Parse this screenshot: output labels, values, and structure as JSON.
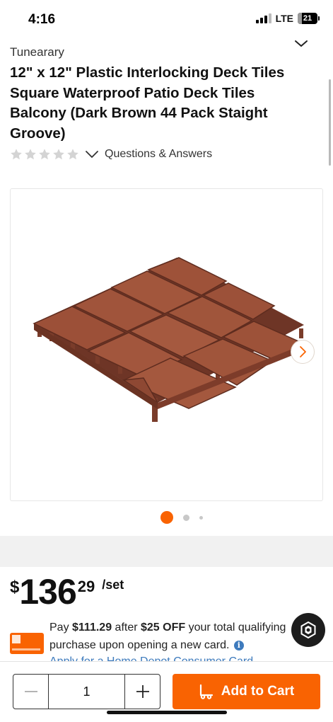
{
  "status_bar": {
    "time": "4:16",
    "network": "LTE",
    "battery": "21",
    "battery_level": 0.21
  },
  "product": {
    "brand": "Tunearary",
    "title": "12\" x 12\" Plastic Interlocking Deck Tiles Square Waterproof Patio Deck Tiles Balcony (Dark Brown 44 Pack Staight Groove)",
    "rating": 0,
    "rating_max": 5,
    "qa_label": "Questions & Answers",
    "image_icon": "deck-tiles-product-image"
  },
  "gallery": {
    "image_count": 3,
    "current_index": 0
  },
  "price": {
    "currency": "$",
    "dollars": "136",
    "cents": "29",
    "unit": "/set"
  },
  "promo": {
    "text_pay": "Pay ",
    "discounted_price": "$111.29",
    "text_after": " after ",
    "discount": "$25 OFF",
    "text_rest": " your total qualifying purchase upon opening a new card.",
    "info_glyph": "i",
    "apply_link": "Apply for a Home Depot Consumer Card"
  },
  "cart_bar": {
    "quantity": "1",
    "add_to_cart_label": "Add to Cart"
  },
  "colors": {
    "accent": "#f96302",
    "link": "#3e7bbd",
    "tile_brown": "#8b4a32"
  }
}
